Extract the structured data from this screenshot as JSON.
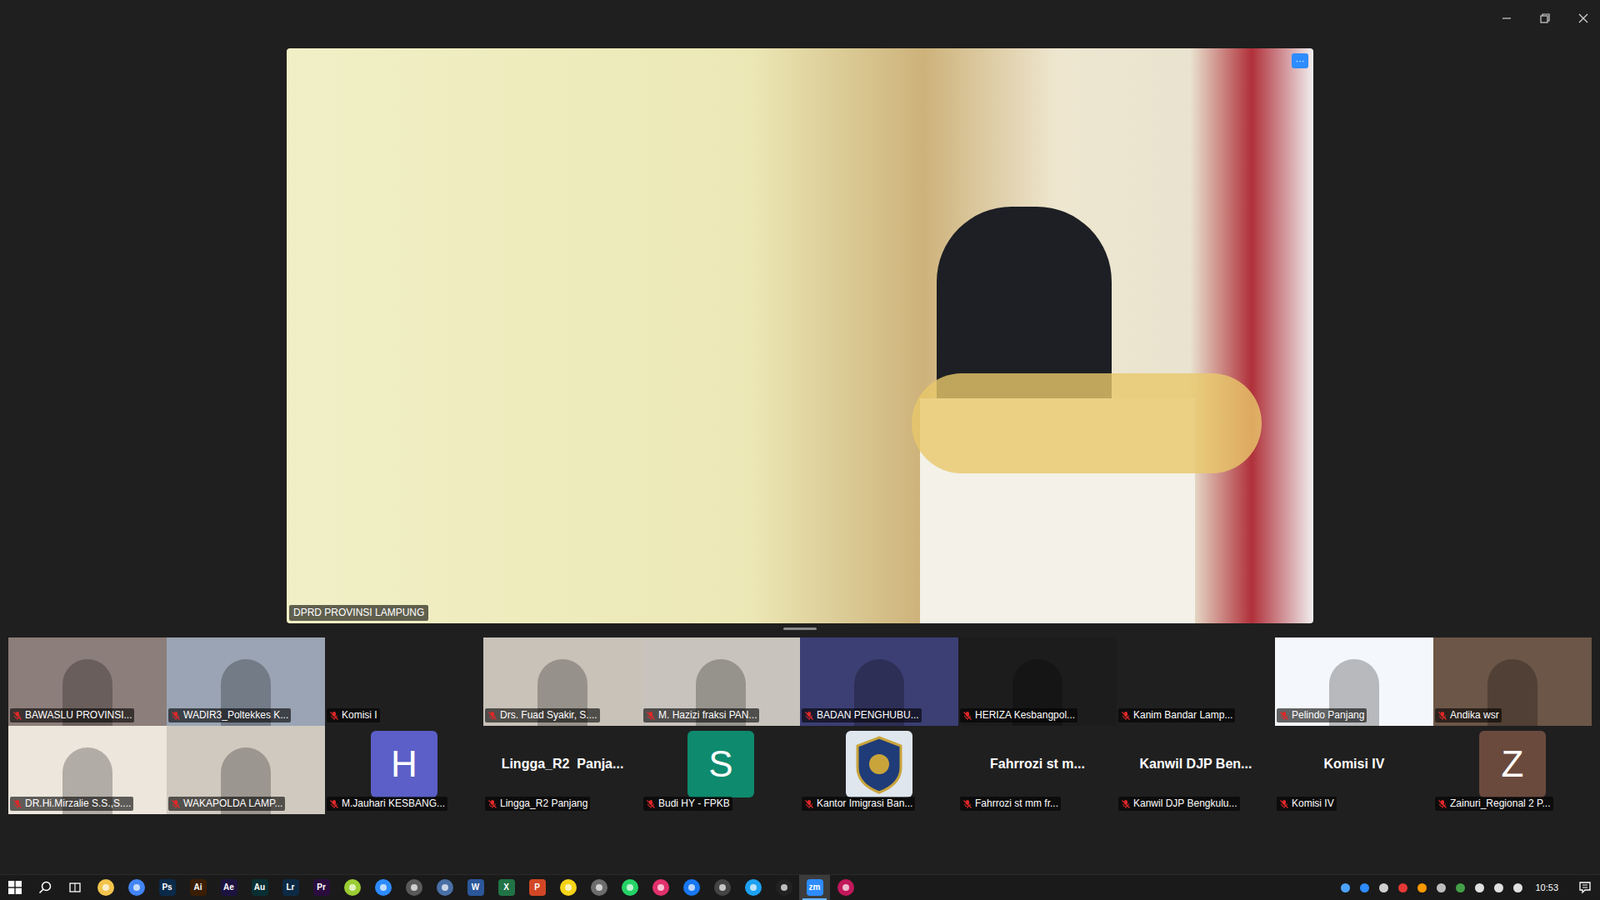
{
  "main_video": {
    "name": "DPRD PROVINSI LAMPUNG",
    "menu": "···"
  },
  "gallery": {
    "rows": [
      [
        {
          "label": "BAWASLU PROVINSI...",
          "kind": "photo",
          "muted": true
        },
        {
          "label": "WADIR3_Poltekkes K...",
          "kind": "photo",
          "muted": true
        },
        {
          "label": "Komisi I",
          "kind": "blank",
          "muted": true
        },
        {
          "label": "Drs. Fuad Syakir, S....",
          "kind": "photo",
          "muted": true
        },
        {
          "label": "M. Hazizi fraksi PAN...",
          "kind": "photo",
          "muted": true
        },
        {
          "label": "BADAN PENGHUBU...",
          "kind": "photo",
          "muted": true
        },
        {
          "label": "HERIZA Kesbangpol...",
          "kind": "photo",
          "muted": true
        },
        {
          "label": "Kanim Bandar Lamp...",
          "kind": "blank",
          "muted": true
        },
        {
          "label": "Pelindo Panjang",
          "kind": "photo",
          "muted": true
        },
        {
          "label": "Andika wsr",
          "kind": "photo",
          "muted": true
        }
      ],
      [
        {
          "label": "DR.Hi.Mirzalie S.S.,S....",
          "kind": "photo",
          "muted": true
        },
        {
          "label": "WAKAPOLDA LAMP...",
          "kind": "photo",
          "muted": true
        },
        {
          "label": "M.Jauhari KESBANG...",
          "kind": "avatar",
          "center": "H",
          "color": "#5b5fc7",
          "muted": true
        },
        {
          "label": "Lingga_R2 Panjang",
          "kind": "name",
          "center": "Lingga_R2  Panja...",
          "muted": true
        },
        {
          "label": "Budi HY - FPKB",
          "kind": "avatar",
          "center": "S",
          "color": "#0e8a6e",
          "muted": true
        },
        {
          "label": "Kantor Imigrasi Ban...",
          "kind": "logo",
          "muted": true
        },
        {
          "label": "Fahrrozi st mm fr...",
          "kind": "name",
          "center": "Fahrrozi st m...",
          "muted": true
        },
        {
          "label": "Kanwil DJP Bengkulu...",
          "kind": "name",
          "center": "Kanwil DJP Ben...",
          "muted": true
        },
        {
          "label": "Komisi IV",
          "kind": "name",
          "center": "Komisi IV",
          "muted": true
        },
        {
          "label": "Zainuri_Regional 2 P...",
          "kind": "avatar",
          "center": "Z",
          "color": "#6b4a3e",
          "muted": true
        }
      ]
    ]
  },
  "taskbar": {
    "apps": [
      {
        "kind": "glyph",
        "color": "#f2c44c",
        "selected": false
      },
      {
        "kind": "glyph",
        "color": "#4285f4",
        "selected": false
      },
      {
        "kind": "letter",
        "text": "Ps",
        "color": "#0b2a4a",
        "selected": false
      },
      {
        "kind": "letter",
        "text": "Ai",
        "color": "#3a1d05",
        "selected": false
      },
      {
        "kind": "letter",
        "text": "Ae",
        "color": "#1d1340",
        "selected": false
      },
      {
        "kind": "letter",
        "text": "Au",
        "color": "#0a2f33",
        "selected": false
      },
      {
        "kind": "letter",
        "text": "Lr",
        "color": "#0c2a44",
        "selected": false
      },
      {
        "kind": "letter",
        "text": "Pr",
        "color": "#2a0d3e",
        "selected": false
      },
      {
        "kind": "glyph",
        "color": "#9acd32",
        "selected": false
      },
      {
        "kind": "glyph",
        "color": "#2d8cff",
        "selected": false
      },
      {
        "kind": "glyph",
        "color": "#5a5a5a",
        "selected": false
      },
      {
        "kind": "glyph",
        "color": "#4a6fa5",
        "selected": false
      },
      {
        "kind": "letter",
        "text": "W",
        "color": "#2b579a",
        "selected": false
      },
      {
        "kind": "letter",
        "text": "X",
        "color": "#217346",
        "selected": false
      },
      {
        "kind": "letter",
        "text": "P",
        "color": "#d24726",
        "selected": false
      },
      {
        "kind": "glyph",
        "color": "#f7d417",
        "selected": false
      },
      {
        "kind": "glyph",
        "color": "#6d6d6d",
        "selected": false
      },
      {
        "kind": "glyph",
        "color": "#25d366",
        "selected": false
      },
      {
        "kind": "glyph",
        "color": "#e1306c",
        "selected": false
      },
      {
        "kind": "glyph",
        "color": "#1877f2",
        "selected": false
      },
      {
        "kind": "glyph",
        "color": "#444444",
        "selected": false
      },
      {
        "kind": "glyph",
        "color": "#1da1f2",
        "selected": false
      },
      {
        "kind": "glyph",
        "color": "#222222",
        "selected": false
      },
      {
        "kind": "letter",
        "text": "zm",
        "color": "#2d8cff",
        "selected": true
      },
      {
        "kind": "glyph",
        "color": "#c2185b",
        "selected": false
      }
    ],
    "clock": "10:53"
  }
}
